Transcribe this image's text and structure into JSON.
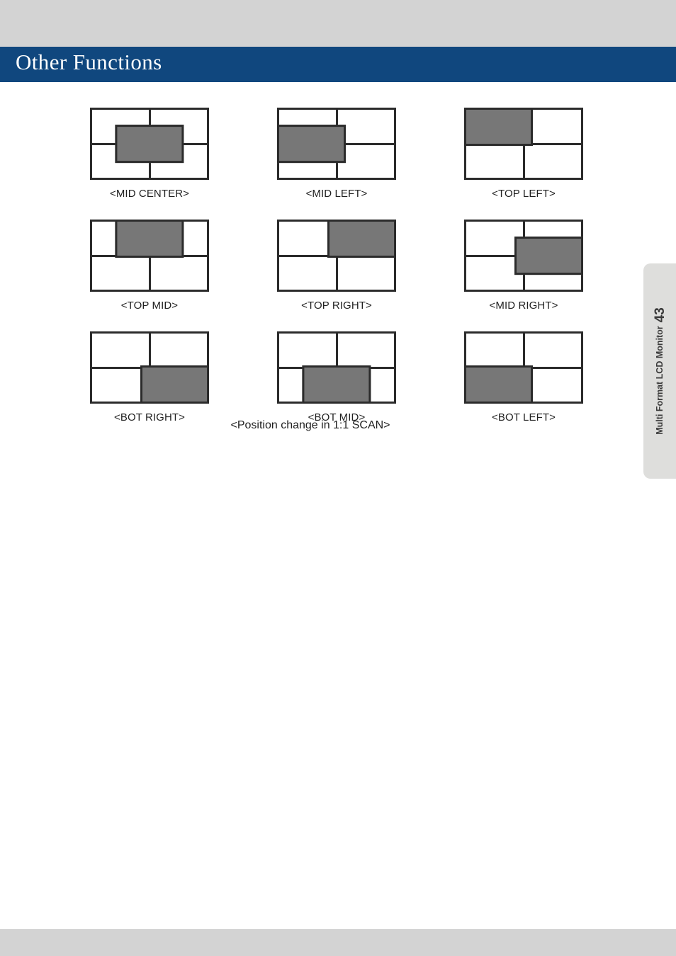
{
  "page": {
    "chapter_title": "Other Functions",
    "header_color": "#10477e",
    "edge_band_color": "#d3d3d3",
    "gray_block_color": "#777777",
    "outline_color": "#2b2b2b"
  },
  "side_tab": {
    "text": "Multi Format LCD Monitor",
    "page_number": "43"
  },
  "figure": {
    "caption": "<Position change in 1:1 SCAN>",
    "rows": [
      [
        {
          "label": "<MID CENTER>",
          "h": "center",
          "v": "mid"
        },
        {
          "label": "<MID LEFT>",
          "h": "left",
          "v": "mid"
        },
        {
          "label": "<TOP LEFT>",
          "h": "left",
          "v": "top"
        }
      ],
      [
        {
          "label": "<TOP MID>",
          "h": "center",
          "v": "top"
        },
        {
          "label": "<TOP RIGHT>",
          "h": "right",
          "v": "top"
        },
        {
          "label": "<MID RIGHT>",
          "h": "right",
          "v": "mid"
        }
      ],
      [
        {
          "label": "<BOT RIGHT>",
          "h": "right",
          "v": "bot"
        },
        {
          "label": "<BOT MID>",
          "h": "center",
          "v": "bot"
        },
        {
          "label": "<BOT LEFT>",
          "h": "left",
          "v": "bot"
        }
      ]
    ]
  }
}
